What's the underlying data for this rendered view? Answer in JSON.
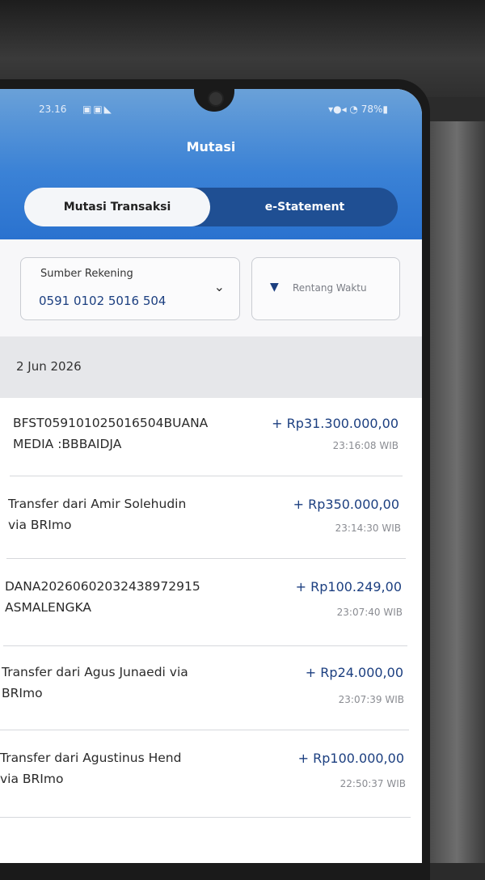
{
  "status_bar": {
    "time": "23.16",
    "notif_icons": "▣▣◣",
    "right": "▾●◂ ◔ 78%▮"
  },
  "header": {
    "title": "Mutasi"
  },
  "tabs": [
    {
      "label": "Mutasi Transaksi",
      "active": true
    },
    {
      "label": "e-Statement",
      "active": false
    }
  ],
  "filters": {
    "sumber_label": "Sumber Rekening",
    "sumber_value": "0591 0102 5016 504",
    "rentang_label": "Rentang Waktu"
  },
  "date_group": "2 Jun 2026",
  "transactions": [
    {
      "desc1": "BFST05910102501650​4BUANA",
      "desc2": "MEDIA :BBBAIDJA",
      "amount": "+ Rp31.300.000,00",
      "time": "23:16:08 WIB"
    },
    {
      "desc1": "Transfer dari Amir Solehudin",
      "desc2": "via BRImo",
      "amount": "+ Rp350.000,00",
      "time": "23:14:30 WIB"
    },
    {
      "desc1": "DANA20260602032438972915",
      "desc2": "ASMALENGKA",
      "amount": "+ Rp100.249,00",
      "time": "23:07:40 WIB"
    },
    {
      "desc1": "Transfer dari Agus Junaedi via",
      "desc2": "BRImo",
      "amount": "+ Rp24.000,00",
      "time": "23:07:39 WIB"
    },
    {
      "desc1": "Transfer dari Agustinus Hend",
      "desc2": "via BRImo",
      "amount": "+ Rp100.000,00",
      "time": "22:50:37 WIB"
    }
  ],
  "colors": {
    "header_blue": "#2a72cf",
    "amount_blue": "#1c3f80"
  }
}
